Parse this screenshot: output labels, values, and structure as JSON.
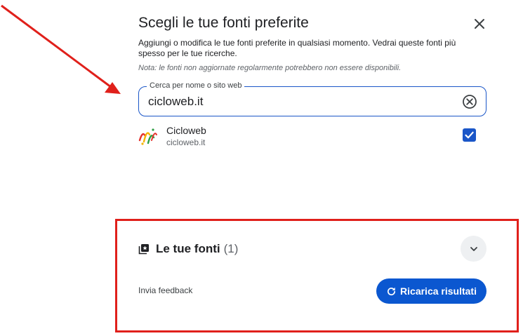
{
  "dialog": {
    "title": "Scegli le tue fonti preferite",
    "description": "Aggiungi o modifica le tue fonti preferite in qualsiasi momento. Vedrai queste fonti più spesso per le tue ricerche.",
    "note": "Nota: le fonti non aggiornate regolarmente potrebbero non essere disponibili.",
    "close_icon": "close-icon"
  },
  "search": {
    "label": "Cerca per nome o sito web",
    "value": "cicloweb.it",
    "clear_icon": "clear-circle-icon"
  },
  "results": [
    {
      "name": "Cicloweb",
      "domain": "cicloweb.it",
      "checked": true,
      "logo_icon": "cicloweb-logo"
    }
  ],
  "your_sources": {
    "title": "Le tue fonti",
    "count": "(1)",
    "icon": "sources-stack-icon",
    "expand_icon": "chevron-down-icon"
  },
  "footer": {
    "feedback": "Invia feedback",
    "reload_label": "Ricarica risultati",
    "reload_icon": "refresh-icon"
  },
  "colors": {
    "accent": "#0b57d0",
    "annotation": "#e0201b",
    "text_primary": "#202124",
    "text_secondary": "#5f6368"
  }
}
